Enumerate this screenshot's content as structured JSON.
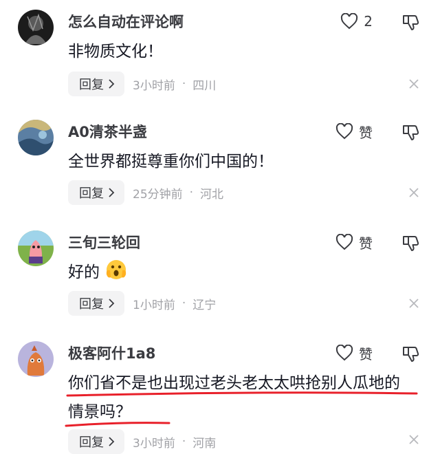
{
  "comments": [
    {
      "username": "怎么自动在评论啊",
      "text": "非物质文化！",
      "like_label": "2",
      "reply_label": "回复",
      "time": "3小时前",
      "location": "四川"
    },
    {
      "username": "A0清茶半盏",
      "text": "全世界都挺尊重你们中国的！",
      "like_label": "赞",
      "reply_label": "回复",
      "time": "25分钟前",
      "location": "河北"
    },
    {
      "username": "三旬三轮回",
      "text": "好的",
      "like_label": "赞",
      "reply_label": "回复",
      "time": "1小时前",
      "location": "辽宁"
    },
    {
      "username": "极客阿什1a8",
      "text": "你们省不是也出现过老头老太太哄抢别人瓜地的情景吗？",
      "like_label": "赞",
      "reply_label": "回复",
      "time": "3小时前",
      "location": "河南"
    }
  ],
  "separator": "·",
  "colors": {
    "text_primary": "#161823",
    "text_secondary": "#3a3b40",
    "meta_grey": "#a0a1a6",
    "reply_bg": "#f3f3f4",
    "highlight_underline": "#e8202a"
  },
  "icons": {
    "like": "heart-outline-icon",
    "dislike": "thumbs-down-outline-icon",
    "reply_chevron": "chevron-right-icon",
    "close": "close-x-icon",
    "emoji": "shocked-face-emoji"
  }
}
